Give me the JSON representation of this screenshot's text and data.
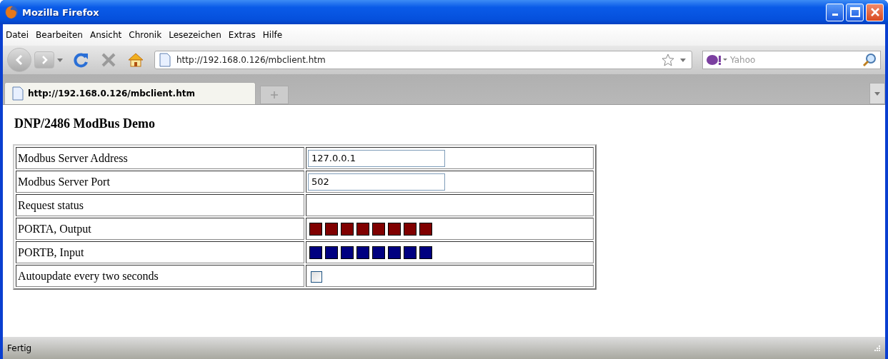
{
  "window": {
    "title": "Mozilla Firefox"
  },
  "menu": [
    "Datei",
    "Bearbeiten",
    "Ansicht",
    "Chronik",
    "Lesezeichen",
    "Extras",
    "Hilfe"
  ],
  "address_bar": {
    "value": "http://192.168.0.126/mbclient.htm"
  },
  "search": {
    "placeholder": "Yahoo"
  },
  "tabs": [
    {
      "label": "http://192.168.0.126/mbclient.htm",
      "selected": true
    }
  ],
  "page": {
    "heading": "DNP/2486 ModBus Demo",
    "rows": [
      {
        "label": "Modbus Server Address",
        "kind": "input",
        "value": "127.0.0.1"
      },
      {
        "label": "Modbus Server Port",
        "kind": "input",
        "value": "502"
      },
      {
        "label": "Request status",
        "kind": "empty"
      },
      {
        "label": "PORTA, Output",
        "kind": "leds",
        "bits": [
          {
            "color": "#800000"
          },
          {
            "color": "#800000"
          },
          {
            "color": "#800000"
          },
          {
            "color": "#800000"
          },
          {
            "color": "#800000"
          },
          {
            "color": "#800000"
          },
          {
            "color": "#800000"
          },
          {
            "color": "#800000"
          }
        ]
      },
      {
        "label": "PORTB, Input",
        "kind": "leds",
        "bits": [
          {
            "color": "#000080"
          },
          {
            "color": "#000080"
          },
          {
            "color": "#000080"
          },
          {
            "color": "#000080"
          },
          {
            "color": "#000080"
          },
          {
            "color": "#000080"
          },
          {
            "color": "#000080"
          },
          {
            "color": "#000080"
          }
        ]
      },
      {
        "label": "Autoupdate every two seconds",
        "kind": "checkbox",
        "checked": false
      }
    ]
  },
  "status_bar": {
    "text": "Fertig"
  }
}
